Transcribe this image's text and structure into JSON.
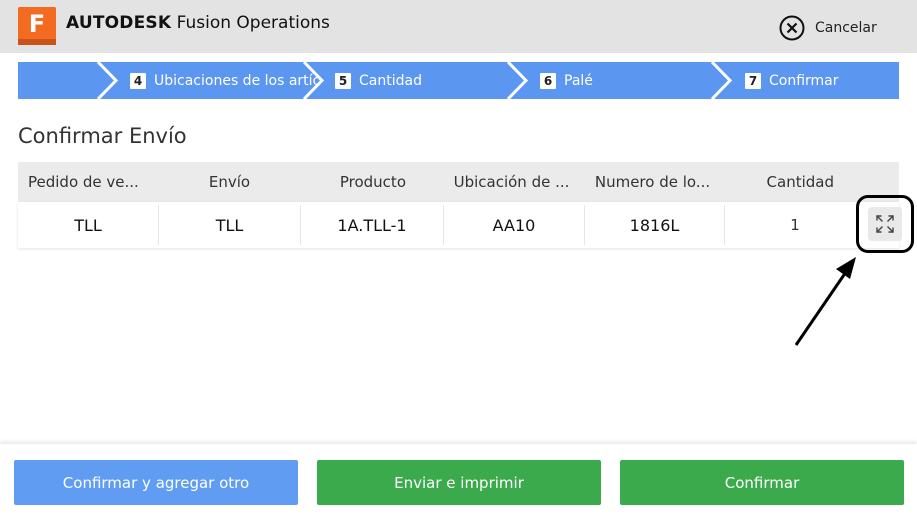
{
  "header": {
    "brand": "AUTODESK",
    "product": "Fusion Operations",
    "logo_letter": "F",
    "cancel_label": "Cancelar"
  },
  "stepper": {
    "steps": [
      {
        "number": "4",
        "label": "Ubicaciones de los artíc"
      },
      {
        "number": "5",
        "label": "Cantidad"
      },
      {
        "number": "6",
        "label": "Palé"
      },
      {
        "number": "7",
        "label": "Confirmar"
      }
    ]
  },
  "section_title": "Confirmar Envío",
  "table": {
    "columns": [
      "Pedido de ve...",
      "Envío",
      "Producto",
      "Ubicación de ...",
      "Numero de lo...",
      "Cantidad"
    ],
    "rows": [
      [
        "TLL",
        "TLL",
        "1A.TLL-1",
        "AA10",
        "1816L",
        "1"
      ]
    ]
  },
  "footer": {
    "confirm_add_label": "Confirmar y agregar otro",
    "send_print_label": "Enviar e imprimir",
    "confirm_label": "Confirmar"
  },
  "colors": {
    "stepper_blue": "#5b97f1",
    "accent_orange": "#f26b21",
    "button_blue": "#5f9cf2",
    "button_green": "#3aaa4c"
  }
}
